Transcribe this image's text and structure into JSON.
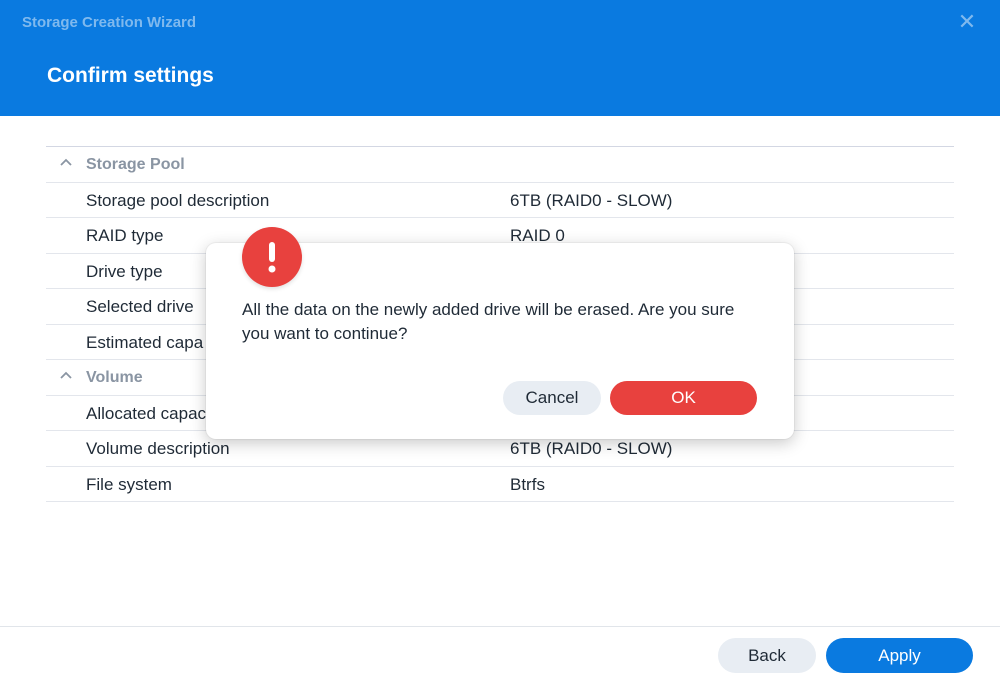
{
  "window": {
    "title": "Storage Creation Wizard",
    "close_label": "✕",
    "step_title": "Confirm settings"
  },
  "storage_pool": {
    "section_label": "Storage Pool",
    "rows": [
      {
        "label": "Storage pool description",
        "value": "6TB (RAID0 - SLOW)"
      },
      {
        "label": "RAID type",
        "value": "RAID 0"
      },
      {
        "label": "Drive type",
        "value": ""
      },
      {
        "label": "Selected drive",
        "value": ""
      },
      {
        "label": "Estimated capa",
        "value": ""
      }
    ]
  },
  "volume": {
    "section_label": "Volume",
    "rows": [
      {
        "label": "Allocated capac",
        "value": ""
      },
      {
        "label": "Volume description",
        "value": "6TB (RAID0 - SLOW)"
      },
      {
        "label": "File system",
        "value": "Btrfs"
      }
    ]
  },
  "footer": {
    "back_label": "Back",
    "apply_label": "Apply"
  },
  "dialog": {
    "icon": "exclamation-icon",
    "icon_glyph": "!",
    "message": "All the data on the newly added drive will be erased. Are you sure you want to continue?",
    "cancel_label": "Cancel",
    "ok_label": "OK"
  },
  "colors": {
    "header_bg": "#0a7ae0",
    "primary": "#0a7ae0",
    "danger": "#e8413e",
    "secondary_btn": "#e8edf3"
  }
}
